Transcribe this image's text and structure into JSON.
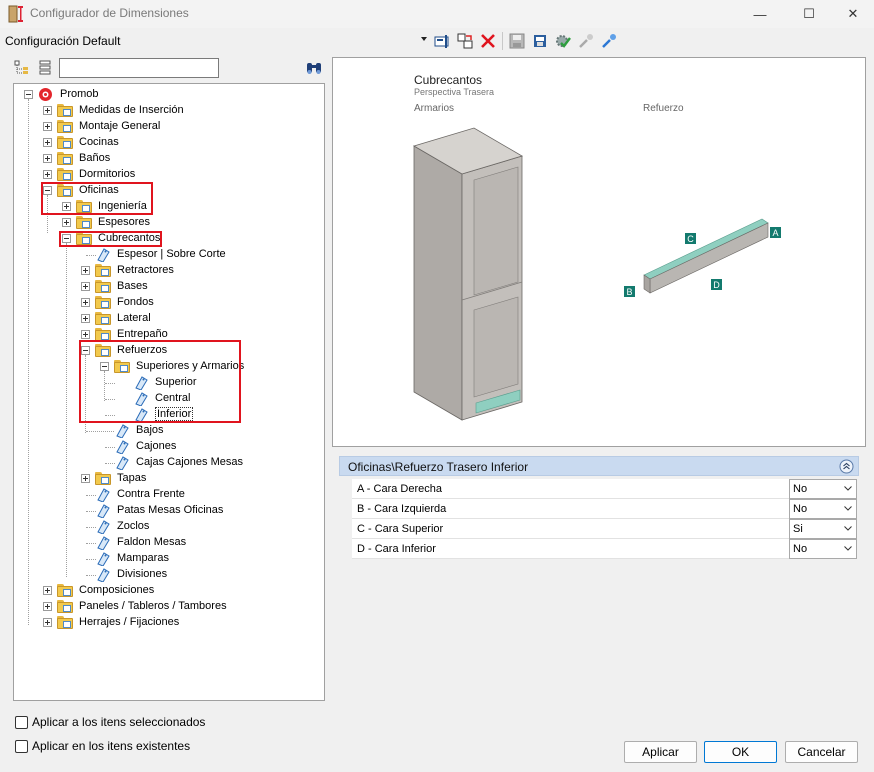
{
  "window": {
    "title": "Configurador de Dimensiones",
    "minimize": "—",
    "maximize": "☐",
    "close": "✕"
  },
  "toolbar": {
    "configuration": "Configuración Default",
    "icons": [
      "edit-icon",
      "copy-icon",
      "delete-icon",
      "save-icon",
      "export-icon",
      "settings-check-icon",
      "pick-gray-icon",
      "pick-blue-icon"
    ]
  },
  "tree": {
    "search_value": "",
    "items": [
      {
        "label": "Promob"
      },
      {
        "label": "Medidas de Inserción"
      },
      {
        "label": "Montaje General"
      },
      {
        "label": "Cocinas"
      },
      {
        "label": "Baños"
      },
      {
        "label": "Dormitorios"
      },
      {
        "label": "Oficinas"
      },
      {
        "label": "Ingeniería"
      },
      {
        "label": "Espesores"
      },
      {
        "label": "Cubrecantos"
      },
      {
        "label": "Espesor | Sobre Corte"
      },
      {
        "label": "Retractores"
      },
      {
        "label": "Bases"
      },
      {
        "label": "Fondos"
      },
      {
        "label": "Lateral"
      },
      {
        "label": "Entrepaño"
      },
      {
        "label": "Refuerzos"
      },
      {
        "label": "Superiores y Armarios"
      },
      {
        "label": "Superior"
      },
      {
        "label": "Central"
      },
      {
        "label": "Inferior"
      },
      {
        "label": "Bajos"
      },
      {
        "label": "Cajones"
      },
      {
        "label": "Cajas Cajones Mesas"
      },
      {
        "label": "Tapas"
      },
      {
        "label": "Contra Frente"
      },
      {
        "label": "Patas Mesas Oficinas"
      },
      {
        "label": "Zoclos"
      },
      {
        "label": "Faldon Mesas"
      },
      {
        "label": "Mamparas"
      },
      {
        "label": "Divisiones"
      },
      {
        "label": "Composiciones"
      },
      {
        "label": "Paneles / Tableros / Tambores"
      },
      {
        "label": "Herrajes / Fijaciones"
      }
    ]
  },
  "preview": {
    "title": "Cubrecantos",
    "subtitle": "Perspectiva Trasera",
    "label_left": "Armarios",
    "label_right": "Refuerzo",
    "markers": {
      "a": "A",
      "b": "B",
      "c": "C",
      "d": "D"
    },
    "colors": {
      "edge": "#8fcfc0",
      "marker": "#137a6e",
      "cabinet": "#b9b6b2"
    }
  },
  "properties": {
    "header": "Oficinas\\Refuerzo Trasero Inferior",
    "rows": [
      {
        "name": "A - Cara Derecha",
        "value": "No"
      },
      {
        "name": "B - Cara Izquierda",
        "value": "No"
      },
      {
        "name": "C - Cara Superior",
        "value": "Si"
      },
      {
        "name": "D - Cara Inferior",
        "value": "No"
      }
    ]
  },
  "footer": {
    "check_selected": "Aplicar a los itens seleccionados",
    "check_existing": "Aplicar en los itens existentes",
    "apply": "Aplicar",
    "ok": "OK",
    "cancel": "Cancelar"
  }
}
